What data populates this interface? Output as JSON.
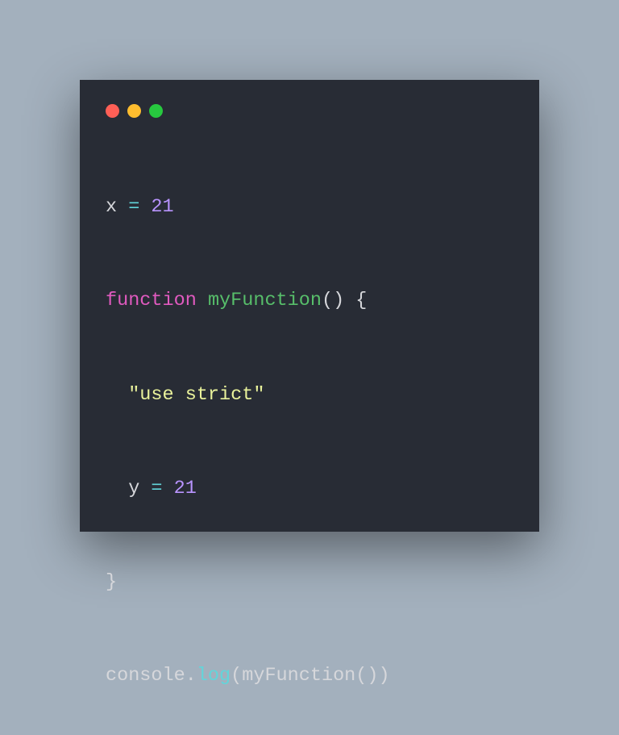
{
  "window": {
    "dots": [
      "red",
      "yellow",
      "green"
    ]
  },
  "code": {
    "line1": {
      "var": "x",
      "eq": " = ",
      "val": "21"
    },
    "line2": {
      "kw": "function",
      "sp": " ",
      "fn": "myFunction",
      "rest": "() {"
    },
    "line3": {
      "str": "\"use strict\""
    },
    "line4": {
      "var": "y",
      "eq": " = ",
      "val": "21"
    },
    "line5": {
      "brace": "}"
    },
    "line6": {
      "obj": "console",
      "dot": ".",
      "method": "log",
      "open": "(",
      "arg": "myFunction()",
      "close": ")"
    }
  }
}
